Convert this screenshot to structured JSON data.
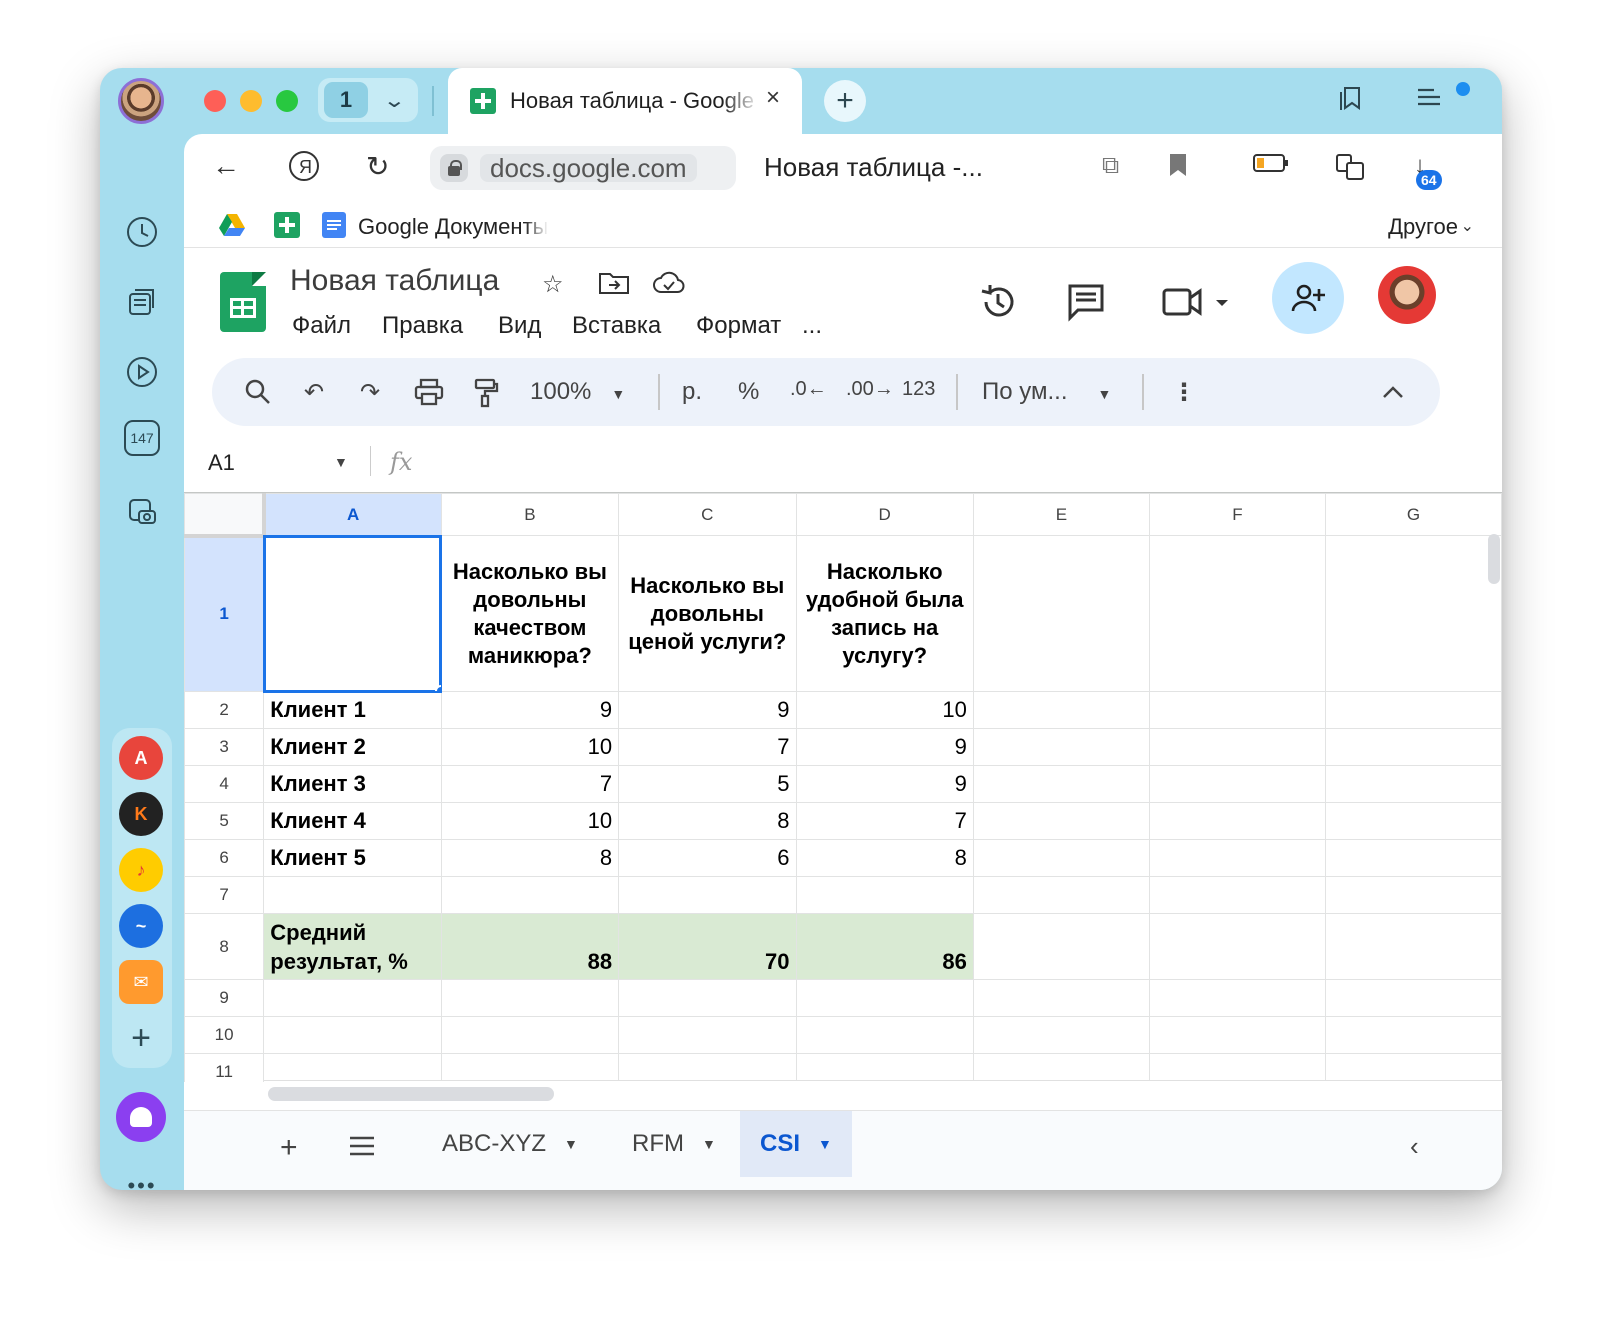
{
  "browser": {
    "tab_count": "1",
    "active_tab_title": "Новая таблица - Google Таблицы",
    "url": "docs.google.com",
    "page_title": "Новая таблица -...",
    "downloads_badge": "64",
    "sidebar_counter": "147",
    "bookmarks": {
      "google_docs": "Google Документы",
      "other": "Другое"
    }
  },
  "sheet_app": {
    "doc_title": "Новая таблица",
    "menu": [
      "Файл",
      "Правка",
      "Вид",
      "Вставка",
      "Формат",
      "..."
    ],
    "toolbar": {
      "zoom": "100%",
      "currency": "р.",
      "percent": "%",
      "dec_decrease": ".0",
      "dec_increase": ".00",
      "number_format": "123",
      "font": "По ум..."
    },
    "name_box": "A1",
    "fx_label": "fx"
  },
  "grid": {
    "columns": [
      "A",
      "B",
      "C",
      "D",
      "E",
      "F",
      "G"
    ],
    "row_numbers": [
      "1",
      "2",
      "3",
      "4",
      "5",
      "6",
      "7",
      "8",
      "9",
      "10",
      "11"
    ],
    "header_row": [
      "",
      "Насколько вы довольны качеством маникюра?",
      "Насколько вы довольны ценой услуги?",
      "Насколько удобной была запись на услугу?"
    ],
    "clients": [
      {
        "name": "Клиент 1",
        "b": "9",
        "c": "9",
        "d": "10"
      },
      {
        "name": "Клиент 2",
        "b": "10",
        "c": "7",
        "d": "9"
      },
      {
        "name": "Клиент 3",
        "b": "7",
        "c": "5",
        "d": "9"
      },
      {
        "name": "Клиент 4",
        "b": "10",
        "c": "8",
        "d": "7"
      },
      {
        "name": "Клиент 5",
        "b": "8",
        "c": "6",
        "d": "8"
      }
    ],
    "average": {
      "label": "Средний результат, %",
      "b": "88",
      "c": "70",
      "d": "86"
    }
  },
  "sheet_tabs": [
    {
      "label": "ABC-XYZ",
      "active": false
    },
    {
      "label": "RFM",
      "active": false
    },
    {
      "label": "CSI",
      "active": true
    }
  ],
  "colors": {
    "accent": "#1a73e8",
    "sheets_green": "#1ea362",
    "average_fill": "#d9ead3",
    "chrome": "#a6ddee"
  }
}
